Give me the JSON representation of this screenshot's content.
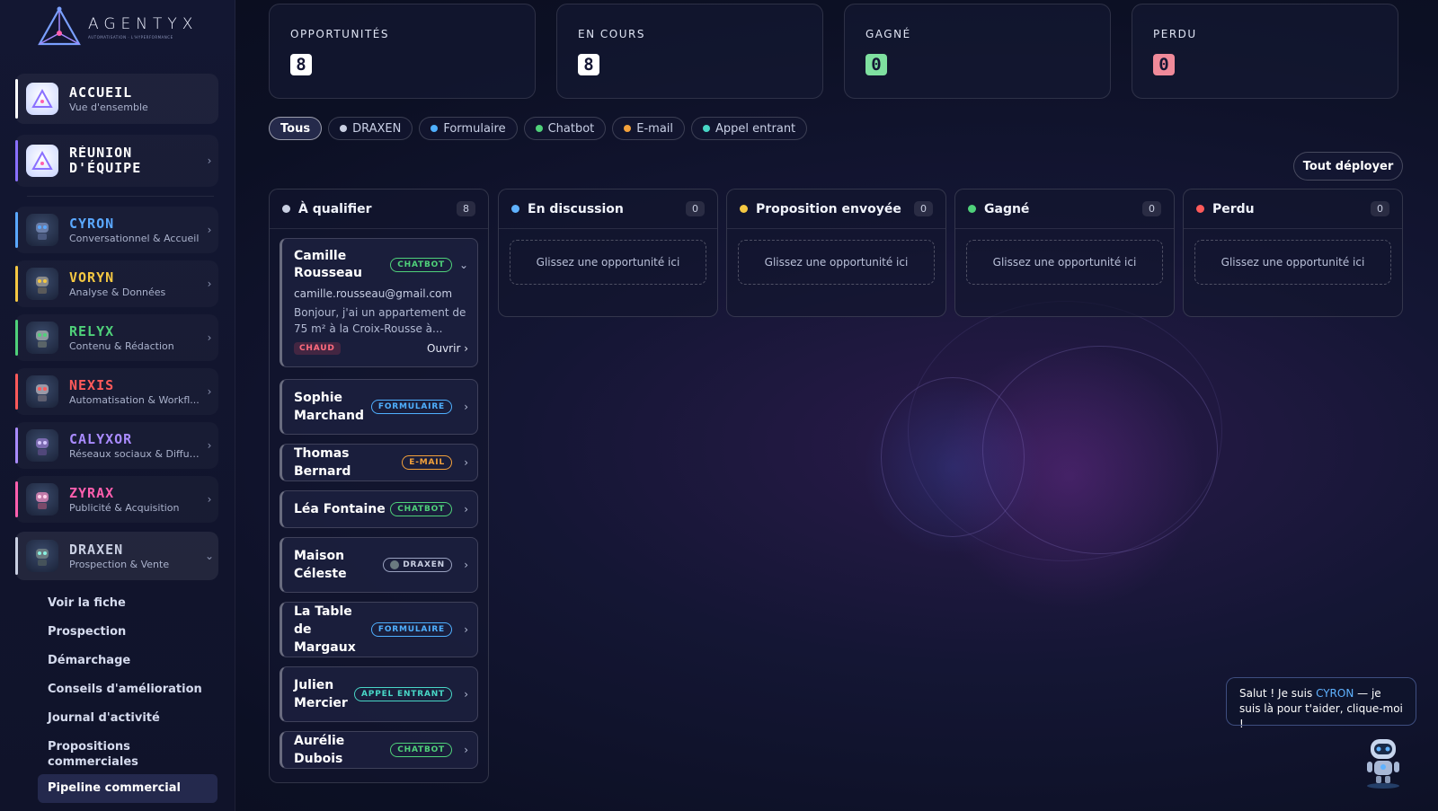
{
  "brand": {
    "name": "AGENTYX",
    "tagline": "AUTOMATISATION · L'HYPERFORMANCE"
  },
  "sidebar": {
    "primary": [
      {
        "title": "ACCUEIL",
        "subtitle": "Vue d'ensemble"
      },
      {
        "title": "RÉUNION D'ÉQUIPE",
        "title_line1": "RÉUNION",
        "title_line2": "D'ÉQUIPE",
        "subtitle": ""
      }
    ],
    "agents": [
      {
        "title": "CYRON",
        "subtitle": "Conversationnel & Accueil",
        "color": "#5aa8ff"
      },
      {
        "title": "VORYN",
        "subtitle": "Analyse & Données",
        "color": "#f5c842"
      },
      {
        "title": "RELYX",
        "subtitle": "Contenu & Rédaction",
        "color": "#4fd17a"
      },
      {
        "title": "NEXIS",
        "subtitle": "Automatisation & Workfl...",
        "color": "#ff5a5a"
      },
      {
        "title": "CALYXOR",
        "subtitle": "Réseaux sociaux & Diffusi...",
        "color": "#a98bff"
      },
      {
        "title": "ZYRAX",
        "subtitle": "Publicité & Acquisition",
        "color": "#ff5fae"
      },
      {
        "title": "DRAXEN",
        "subtitle": "Prospection & Vente",
        "color": "#c9cfe2"
      }
    ],
    "draxen_menu": [
      "Voir la fiche",
      "Prospection",
      "Démarchage",
      "Conseils d'amélioration",
      "Journal d'activité",
      "Propositions commerciales",
      "Pipeline commercial"
    ],
    "draxen_menu_multi": {
      "line1": "Propositions",
      "line2": "commerciales"
    }
  },
  "stats": [
    {
      "label": "OPPORTUNITÉS",
      "value": "8"
    },
    {
      "label": "EN COURS",
      "value": "8"
    },
    {
      "label": "GAGNÉ",
      "value": "0"
    },
    {
      "label": "PERDU",
      "value": "0"
    }
  ],
  "filters": [
    {
      "label": "Tous",
      "color": ""
    },
    {
      "label": "DRAXEN",
      "color": "#c9cfe2"
    },
    {
      "label": "Formulaire",
      "color": "#4fb0ff"
    },
    {
      "label": "Chatbot",
      "color": "#4fd17a"
    },
    {
      "label": "E-mail",
      "color": "#f3a13b"
    },
    {
      "label": "Appel entrant",
      "color": "#48d6c6"
    }
  ],
  "expand_all_label": "Tout déployer",
  "columns": [
    {
      "title": "À qualifier",
      "count": "8",
      "color": "#c9cfe2"
    },
    {
      "title": "En discussion",
      "count": "0",
      "color": "#5fb2ff"
    },
    {
      "title": "Proposition envoyée",
      "count": "0",
      "color": "#f5c842"
    },
    {
      "title": "Gagné",
      "count": "0",
      "color": "#4fd17a"
    },
    {
      "title": "Perdu",
      "count": "0",
      "color": "#ff5a5a"
    }
  ],
  "drop_placeholder": "Glissez une opportunité ici",
  "cards": [
    {
      "name_line1": "Camille",
      "name_line2": "Rousseau",
      "badge": "CHATBOT",
      "email": "camille.rousseau@gmail.com",
      "message_line1": "Bonjour, j'ai un appartement de",
      "message_line2": "75 m² à la Croix-Rousse à...",
      "tag": "CHAUD",
      "open_label": "Ouvrir ›"
    },
    {
      "name_line1": "Sophie",
      "name_line2": "Marchand",
      "badge": "FORMULAIRE"
    },
    {
      "name_line1": "Thomas Bernard",
      "name_line2": "",
      "badge": "E-MAIL"
    },
    {
      "name_line1": "Léa Fontaine",
      "name_line2": "",
      "badge": "CHATBOT"
    },
    {
      "name_line1": "Maison",
      "name_line2": "Céleste",
      "badge": "DRAXEN"
    },
    {
      "name_line1": "La Table de",
      "name_line2": "Margaux",
      "badge": "FORMULAIRE"
    },
    {
      "name_line1": "Julien",
      "name_line2": "Mercier",
      "badge": "APPEL ENTRANT"
    },
    {
      "name_line1": "Aurélie Dubois",
      "name_line2": "",
      "badge": "CHATBOT"
    }
  ],
  "chat": {
    "prefix": "Salut ! Je suis ",
    "name": "CYRON",
    "suffix": " — je suis là pour t'aider, clique-moi !"
  }
}
